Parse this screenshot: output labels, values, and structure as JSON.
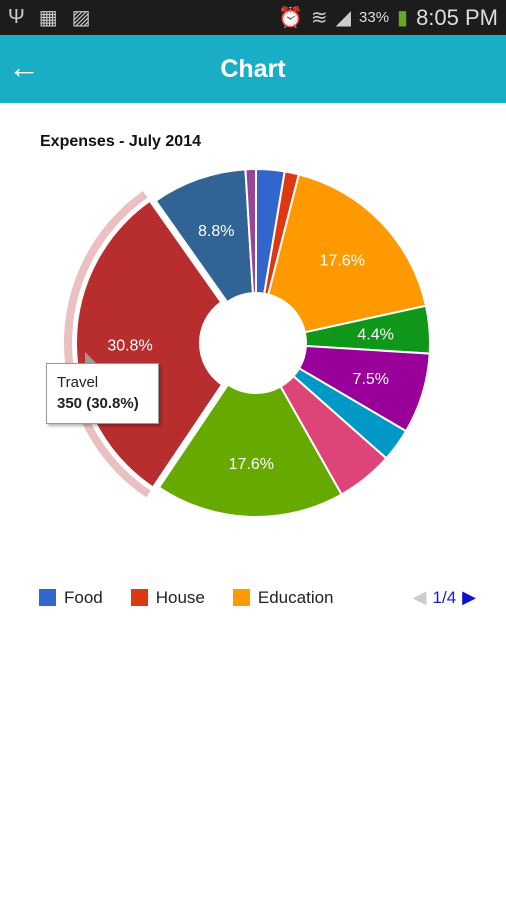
{
  "status_bar": {
    "battery": "33%",
    "time": "8:05 PM",
    "icons": [
      "usb-icon",
      "sim-icon",
      "image-icon",
      "alarm-icon",
      "wifi-icon",
      "signal-icon",
      "battery-charging-icon"
    ]
  },
  "app_bar": {
    "title": "Chart",
    "back_icon": "arrow-left-icon"
  },
  "tooltip": {
    "label": "Travel",
    "value": "350 (30.8%)"
  },
  "legend": {
    "items": [
      {
        "label": "Food",
        "color": "#3366cc"
      },
      {
        "label": "House",
        "color": "#dc3912"
      },
      {
        "label": "Education",
        "color": "#ff9900"
      }
    ],
    "page": "1/4"
  },
  "chart_data": {
    "type": "pie",
    "donut": true,
    "title": "Expenses - July 2014",
    "highlighted": "Travel",
    "slices": [
      {
        "name": "Food",
        "value": 30,
        "color": "#3366cc",
        "label": ""
      },
      {
        "name": "House",
        "value": 15,
        "color": "#dc3912",
        "label": ""
      },
      {
        "name": "Education",
        "value": 200,
        "color": "#ff9900",
        "label": "17.6%"
      },
      {
        "value": 50,
        "color": "#109618",
        "label": "4.4%"
      },
      {
        "value": 85,
        "color": "#990099",
        "label": "7.5%"
      },
      {
        "value": 35,
        "color": "#0099c6",
        "label": ""
      },
      {
        "value": 60,
        "color": "#dd4477",
        "label": ""
      },
      {
        "value": 200,
        "color": "#66aa00",
        "label": "17.6%"
      },
      {
        "name": "Travel",
        "value": 350,
        "color": "#b82e2e",
        "label": "30.8%"
      },
      {
        "value": 100,
        "color": "#316395",
        "label": "8.8%"
      },
      {
        "value": 11,
        "color": "#994499",
        "label": ""
      }
    ]
  }
}
